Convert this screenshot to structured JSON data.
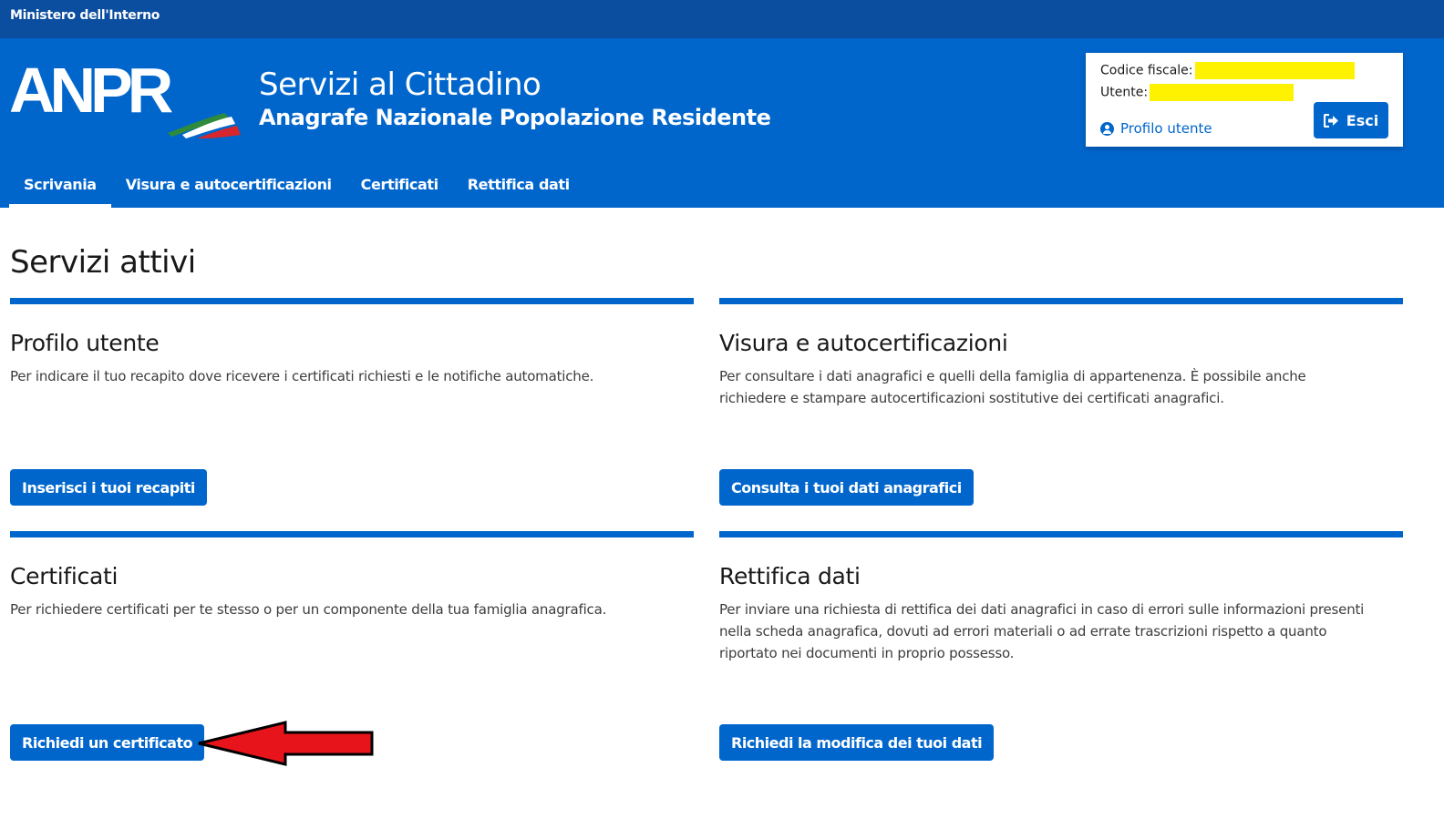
{
  "topbar": {
    "ministry": "Ministero dell'Interno"
  },
  "header": {
    "logo_text": "ANPR",
    "title": "Servizi al Cittadino",
    "subtitle": "Anagrafe Nazionale Popolazione Residente"
  },
  "user": {
    "codice_fiscale_label": "Codice fiscale:",
    "utente_label": "Utente:",
    "profile_link": "Profilo utente",
    "logout_label": "Esci",
    "redaction_color": "#fff200"
  },
  "nav": {
    "tabs": [
      {
        "label": "Scrivania",
        "active": true
      },
      {
        "label": "Visura e autocertificazioni",
        "active": false
      },
      {
        "label": "Certificati",
        "active": false
      },
      {
        "label": "Rettifica dati",
        "active": false
      }
    ]
  },
  "main": {
    "title": "Servizi attivi",
    "cards": [
      {
        "title": "Profilo utente",
        "description": "Per indicare il tuo recapito dove ricevere i certificati richiesti e le notifiche automatiche.",
        "button": "Inserisci i tuoi recapiti"
      },
      {
        "title": "Visura e autocertificazioni",
        "description": "Per consultare i dati anagrafici e quelli della famiglia di appartenenza. È possibile anche richiedere e stampare autocertificazioni sostitutive dei certificati anagrafici.",
        "button": "Consulta i tuoi dati anagrafici"
      },
      {
        "title": "Certificati",
        "description": "Per richiedere certificati per te stesso o per un componente della tua famiglia anagrafica.",
        "button": "Richiedi un certificato"
      },
      {
        "title": "Rettifica dati",
        "description": "Per inviare una richiesta di rettifica dei dati anagrafici in caso di errori sulle informazioni presenti nella scheda anagrafica, dovuti ad errori materiali o ad errate trascrizioni rispetto a quanto riportato nei documenti in proprio possesso.",
        "button": "Richiedi la modifica dei tuoi dati"
      }
    ]
  },
  "colors": {
    "primary": "#0066cc",
    "topbar": "#0b4d9f",
    "annotation_arrow": "#e8141b"
  },
  "icons": {
    "profile": "user-circle-icon",
    "logout": "sign-out-icon",
    "annotation": "red-arrow-icon"
  }
}
